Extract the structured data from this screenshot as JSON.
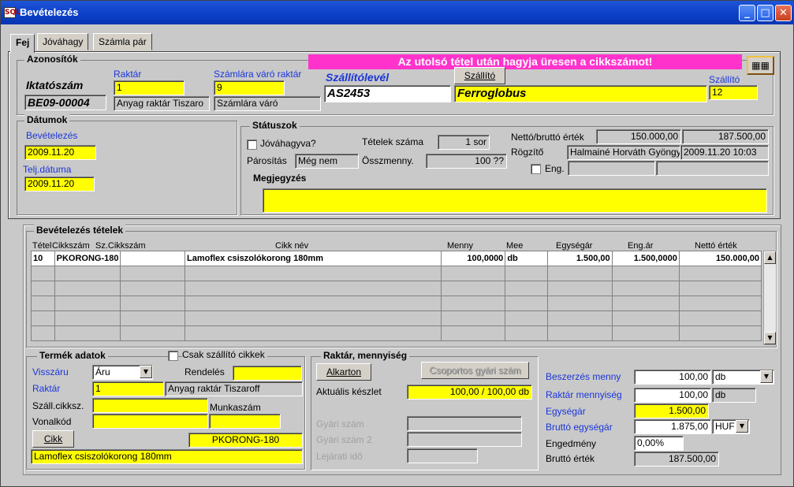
{
  "window": {
    "title": "Bevételezés",
    "app_icon": "SQL"
  },
  "tabs": [
    "Fej",
    "Jóváhagy",
    "Számla pár"
  ],
  "banner": "Az utolsó tétel után hagyja üresen a cikkszámot!",
  "azonositok": {
    "title": "Azonosítók",
    "iktatoszam_label": "Iktatószám",
    "iktatoszam": "BE09-00004",
    "raktar_label": "Raktár",
    "raktar_code": "1",
    "raktar_name": "Anyag raktár Tiszaro",
    "szamlara_label": "Számlára váró raktár",
    "szamlara_code": "9",
    "szamlara_name": "Számlára váró",
    "szallitolevel_label": "Szállítólevél",
    "szallitolevel": "AS2453",
    "szallito_button": "Szállító",
    "szallito_name": "Ferroglobus",
    "szallito_label": "Szállító",
    "szallito_code": "12"
  },
  "datumok": {
    "title": "Dátumok",
    "bevetelezes_label": "Bevételezés",
    "bevetelezes": "2009.11.20",
    "telj_label": "Telj.dátuma",
    "telj": "2009.11.20"
  },
  "statuszok": {
    "title": "Státuszok",
    "jovahagyva_label": "Jóváhagyva?",
    "tetelek_label": "Tételek száma",
    "tetelek": "1 sor",
    "parositas_label": "Párosítás",
    "parositas": "Még nem",
    "osszmenny_label": "Összmenny.",
    "osszmenny": "100 ??",
    "netto_brutto_label": "Nettó/bruttó érték",
    "netto": "150.000,00",
    "brutto": "187.500,00",
    "rogzito_label": "Rögzítő",
    "rogzito": "Halmainé Horváth Gyöngy",
    "rogzito_date": "2009.11.20 10:03",
    "eng_label": "Eng.",
    "megjegyzes_label": "Megjegyzés",
    "megjegyzes": ""
  },
  "tetelek": {
    "title": "Bevételezés tételek",
    "columns": [
      "Tétel",
      "Cikkszám",
      "Sz.Cikkszám",
      "Cikk név",
      "Menny",
      "Mee",
      "Egységár",
      "Eng.ár",
      "Nettó érték"
    ],
    "rows": [
      [
        "10",
        "PKORONG-180",
        "",
        "Lamoflex csiszolókorong 180mm",
        "100,0000",
        "db",
        "1.500,00",
        "1.500,0000",
        "150.000,00"
      ]
    ]
  },
  "termek": {
    "title": "Termék adatok",
    "csak_label": "Csak szállító cikkek",
    "visszaru_label": "Visszáru",
    "visszaru": "Áru",
    "rendeles_label": "Rendelés",
    "rendeles": "",
    "raktar_label": "Raktár",
    "raktar_code": "1",
    "raktar_name": "Anyag raktár Tiszaroff",
    "szall_label": "Száll.cikksz.",
    "szall": "",
    "munkaszam_label": "Munkaszám",
    "munkaszam": "",
    "vonalkod_label": "Vonalkód",
    "vonalkod": "",
    "cikk_button": "Cikk",
    "cikkszam": "PKORONG-180",
    "cikknev": "Lamoflex csiszolókorong 180mm"
  },
  "raktar": {
    "title": "Raktár, mennyiség",
    "alkarton_button": "Alkarton",
    "csoportos_button": "Csoportos gyári szám",
    "aktualis_label": "Aktuális készlet",
    "aktualis": "100,00 / 100,00 db",
    "gyari_label": "Gyári szám",
    "gyari2_label": "Gyári szám 2",
    "lejarati_label": "Lejárati idő"
  },
  "ar": {
    "beszerzes_label": "Beszerzés menny",
    "beszerzes": "100,00",
    "beszerzes_unit": "db",
    "raktarmenny_label": "Raktár mennyiség",
    "raktarmenny": "100,00",
    "raktarmenny_unit": "db",
    "egysegar_label": "Egységár",
    "egysegar": "1.500,00",
    "brutto_egysegar_label": "Bruttó egységár",
    "brutto_egysegar": "1.875,00",
    "currency": "HUF",
    "engedmeny_label": "Engedmény",
    "engedmeny": "0,00%",
    "brutto_ertek_label": "Bruttó érték",
    "brutto_ertek": "187.500,00"
  }
}
